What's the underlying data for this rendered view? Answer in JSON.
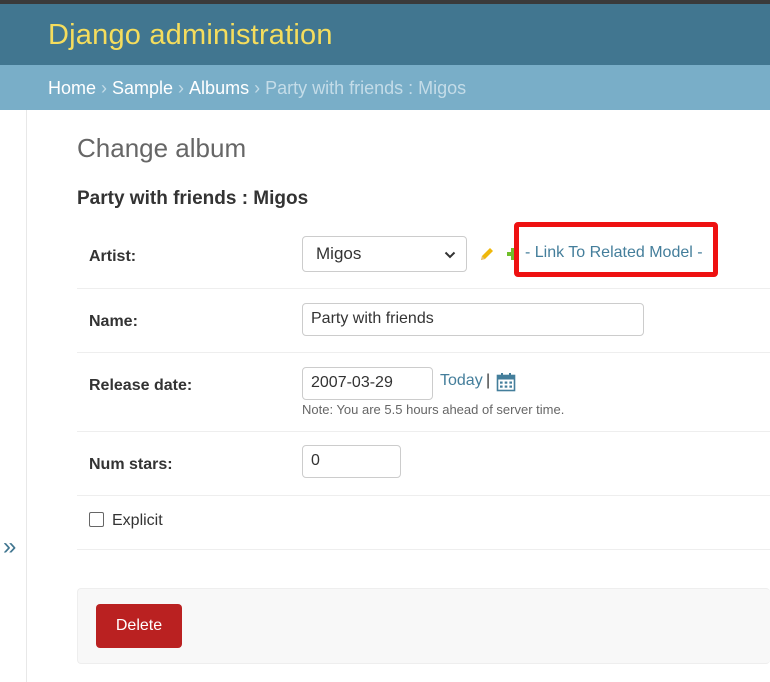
{
  "header": {
    "site_title": "Django administration"
  },
  "breadcrumbs": {
    "items": [
      "Home",
      "Sample",
      "Albums"
    ],
    "separator": "›",
    "current": "Party with friends : Migos"
  },
  "nav_toggle": {
    "glyph": "»",
    "icon": "double-chevron-right-icon"
  },
  "page": {
    "heading": "Change album",
    "object_title": "Party with friends : Migos"
  },
  "form": {
    "artist": {
      "label": "Artist:",
      "selected": "Migos",
      "edit_icon": "pencil-icon",
      "add_icon": "plus-icon",
      "related_link": "- Link To Related Model -"
    },
    "name": {
      "label": "Name:",
      "value": "Party with friends"
    },
    "release_date": {
      "label": "Release date:",
      "value": "2007-03-29",
      "today_link": "Today",
      "separator": "|",
      "calendar_icon": "calendar-icon",
      "help_text": "Note: You are 5.5 hours ahead of server time."
    },
    "num_stars": {
      "label": "Num stars:",
      "value": "0"
    },
    "explicit": {
      "label": "Explicit",
      "checked": false
    }
  },
  "actions": {
    "delete_label": "Delete"
  },
  "colors": {
    "header_bg": "#417690",
    "title_yellow": "#f5dd5d",
    "breadcrumb_bg": "#79aec8",
    "link": "#447e9b",
    "delete_bg": "#ba2121",
    "highlight_red": "#ee1111"
  }
}
